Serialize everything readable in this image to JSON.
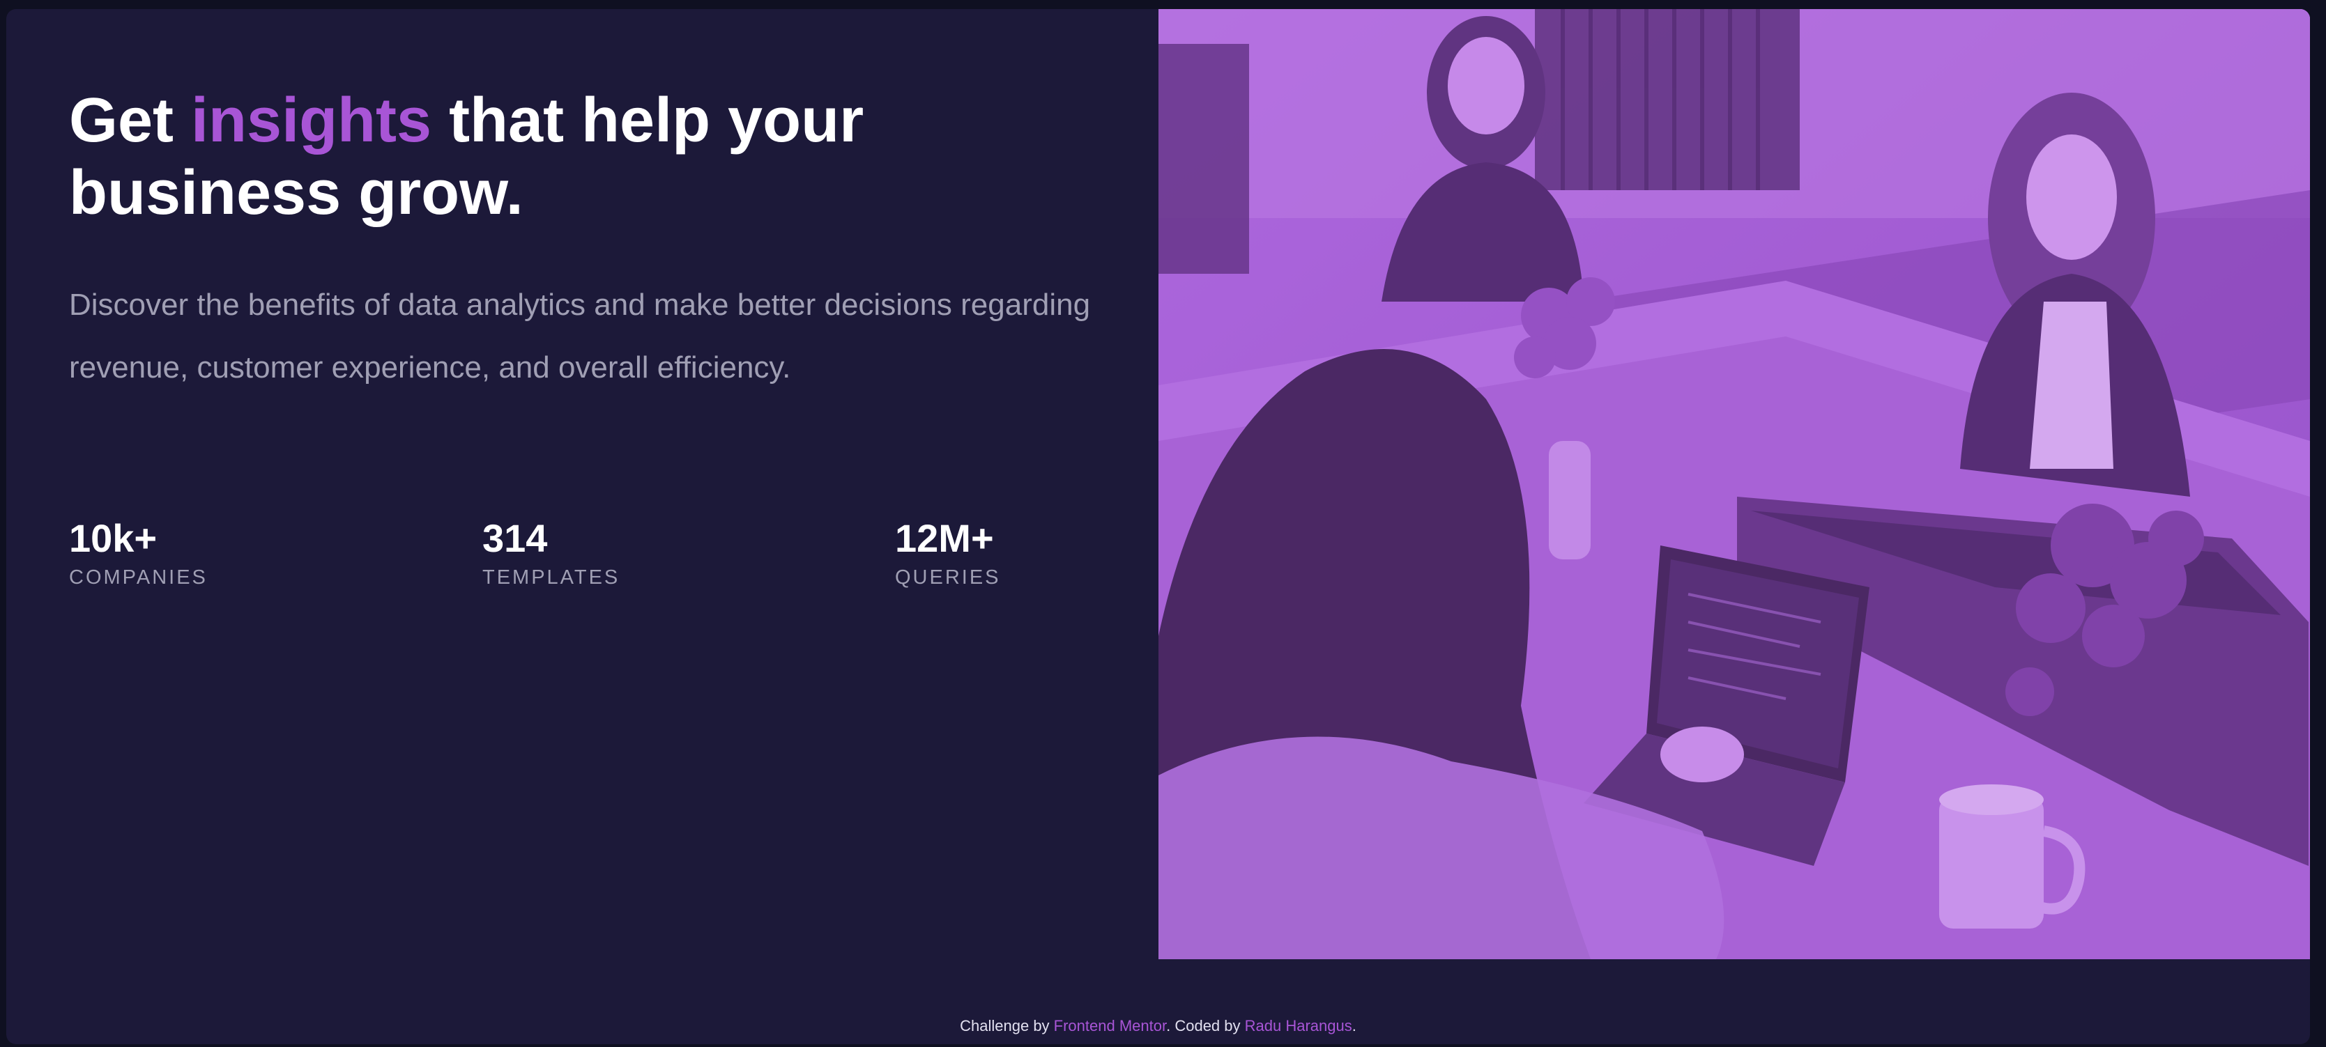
{
  "hero": {
    "title_before": "Get ",
    "title_accent": "insights",
    "title_after": " that help your business grow.",
    "description": "Discover the benefits of data analytics and make better decisions regarding revenue, customer experience, and overall efficiency."
  },
  "stats": [
    {
      "value": "10k+",
      "label": "COMPANIES"
    },
    {
      "value": "314",
      "label": "TEMPLATES"
    },
    {
      "value": "12M+",
      "label": "QUERIES"
    }
  ],
  "image": {
    "icon": "office-team-photo"
  },
  "footer": {
    "prefix": "Challenge by ",
    "link1": "Frontend Mentor",
    "middle": ". Coded by ",
    "link2": "Radu Harangus",
    "suffix": "."
  },
  "colors": {
    "background": "#1c1939",
    "accent": "#a855d6",
    "text": "#ffffff",
    "muted": "#a09fb4"
  }
}
